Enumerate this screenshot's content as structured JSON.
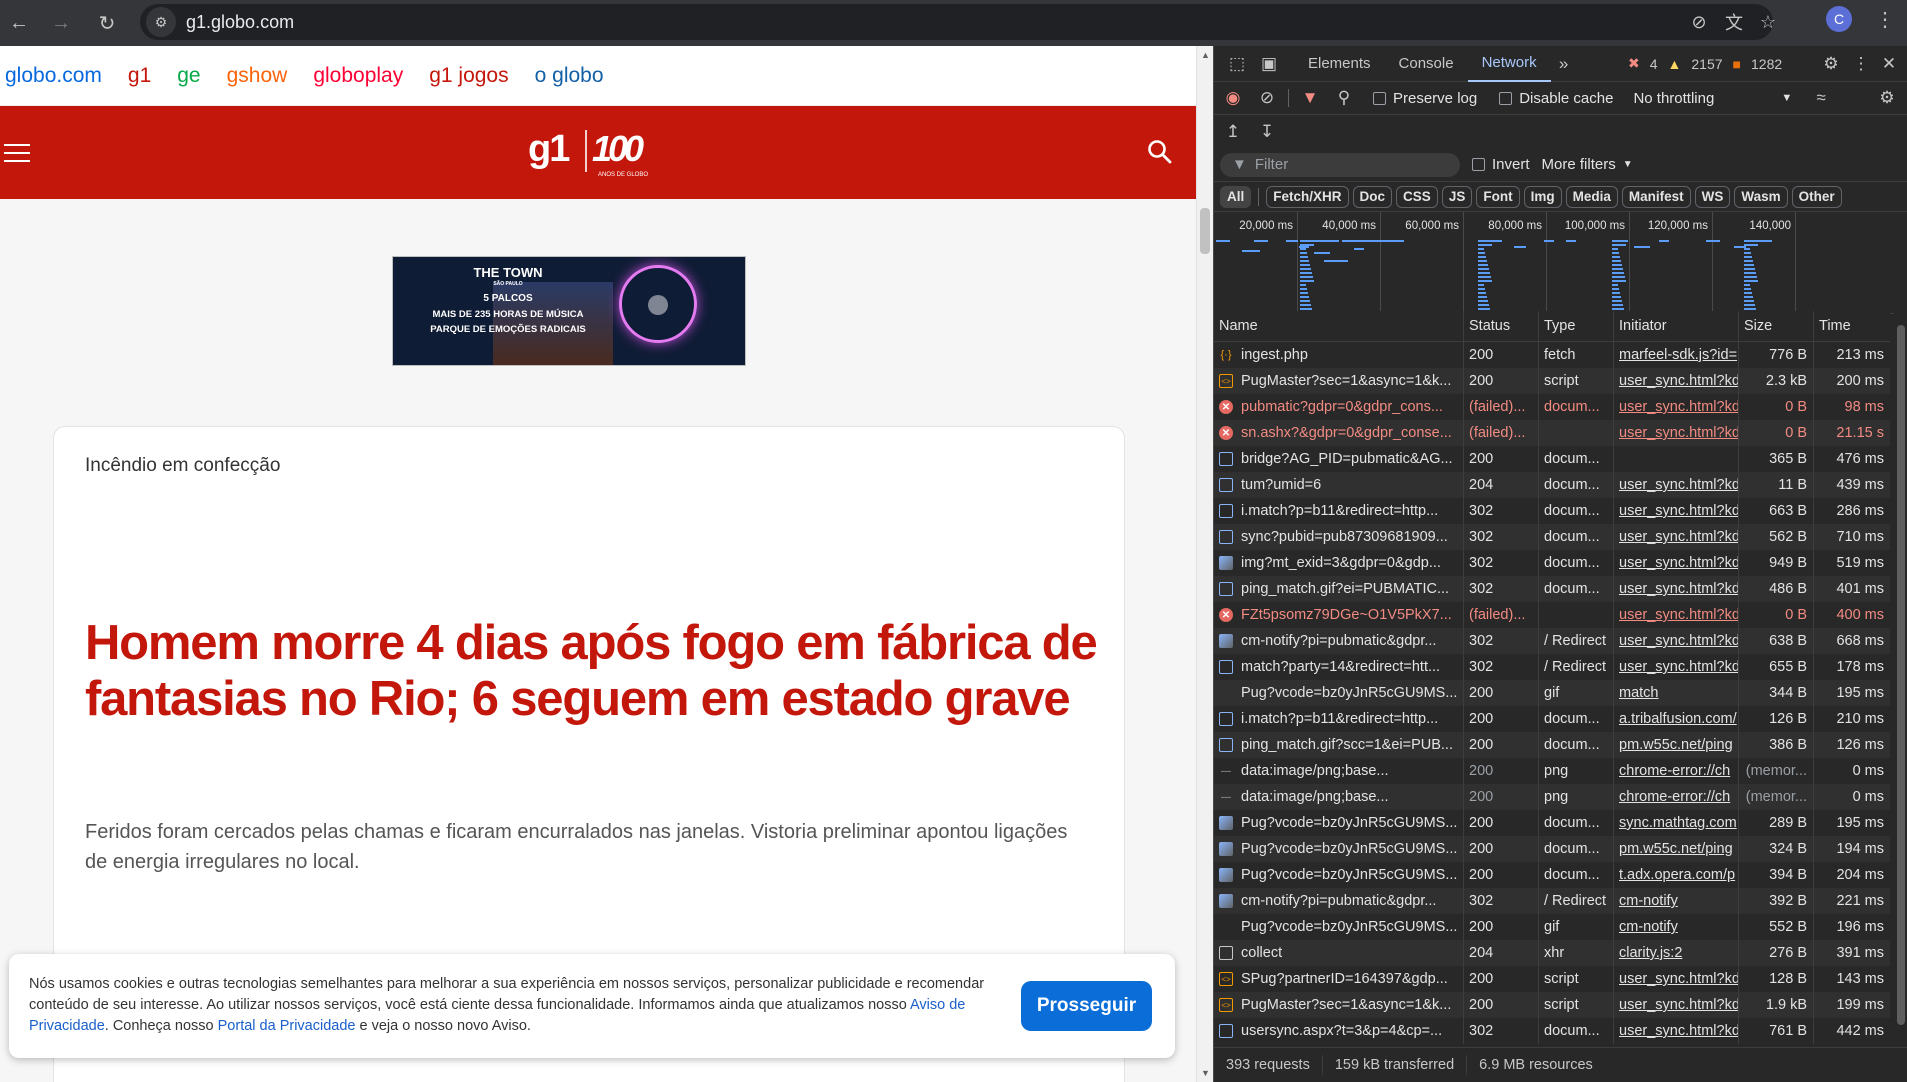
{
  "browser": {
    "url": "g1.globo.com",
    "profile_initial": "C",
    "icons": [
      "back-icon",
      "forward-icon",
      "reload-icon",
      "site-info-icon",
      "eye-off-icon",
      "translate-icon",
      "star-icon",
      "menu-icon"
    ]
  },
  "page": {
    "globo_links": [
      {
        "label": "globo.com",
        "color": "#0669de"
      },
      {
        "label": "g1",
        "color": "#c4170c"
      },
      {
        "label": "ge",
        "color": "#06aa48"
      },
      {
        "label": "gshow",
        "color": "#fa640a"
      },
      {
        "label": "globoplay",
        "color": "#fb0234"
      },
      {
        "label": "g1 jogos",
        "color": "#c4170c"
      },
      {
        "label": "o globo",
        "color": "#1460a7"
      }
    ],
    "logo": {
      "brand": "g1",
      "anniversary": "100",
      "anniversary_sub": "ANOS DE GLOBO"
    },
    "ad": {
      "title": "THE TOWN",
      "subtitle": "SÃO PAULO",
      "line1": "5 PALCOS",
      "line2": "MAIS DE 235 HORAS DE MÚSICA",
      "line3": "PARQUE DE EMOÇÕES RADICAIS"
    },
    "article": {
      "kicker": "Incêndio em confecção",
      "headline": "Homem morre 4 dias após fogo em fábrica de fantasias no Rio; 6 seguem em estado grave",
      "subhead": "Feridos foram cercados pelas chamas e ficaram encurralados nas janelas. Vistoria preliminar apontou ligações de energia irregulares no local."
    },
    "cookie": {
      "text_before": "Nós usamos cookies e outras tecnologias semelhantes para melhorar a sua experiência em nossos serviços, personalizar publicidade e recomendar conteúdo de seu interesse. Ao utilizar nossos serviços, você está ciente dessa funcionalidade. Informamos ainda que atualizamos nosso ",
      "link1": "Aviso de Privacidade",
      "text_mid": ". Conheça nosso ",
      "link2": "Portal da Privacidade",
      "text_after": " e veja o nosso novo Aviso.",
      "button": "Prosseguir"
    }
  },
  "devtools": {
    "tabs": [
      "Elements",
      "Console",
      "Network"
    ],
    "active_tab": "Network",
    "errors": "4",
    "warnings": "2157",
    "issues": "1282",
    "toolbar": {
      "preserve_log": "Preserve log",
      "disable_cache": "Disable cache",
      "throttling": "No throttling"
    },
    "filter": {
      "placeholder": "Filter",
      "invert": "Invert",
      "more_filters": "More filters"
    },
    "types": [
      "All",
      "Fetch/XHR",
      "Doc",
      "CSS",
      "JS",
      "Font",
      "Img",
      "Media",
      "Manifest",
      "WS",
      "Wasm",
      "Other"
    ],
    "timeline_ticks": [
      "20,000 ms",
      "40,000 ms",
      "60,000 ms",
      "80,000 ms",
      "100,000 ms",
      "120,000 ms",
      "140,000"
    ],
    "columns": [
      "Name",
      "Status",
      "Type",
      "Initiator",
      "Size",
      "Time"
    ],
    "rows": [
      {
        "icon": "fetch",
        "name": "ingest.php",
        "status": "200",
        "type": "fetch",
        "initiator": "marfeel-sdk.js?id=",
        "size": "776 B",
        "time": "213 ms"
      },
      {
        "icon": "script",
        "name": "PugMaster?sec=1&async=1&k...",
        "status": "200",
        "type": "script",
        "initiator": "user_sync.html?kd",
        "size": "2.3 kB",
        "time": "200 ms"
      },
      {
        "icon": "err",
        "name": "pubmatic?gdpr=0&gdpr_cons...",
        "status": "(failed)...",
        "type": "docum...",
        "initiator": "user_sync.html?kd",
        "size": "0 B",
        "time": "98 ms",
        "failed": true
      },
      {
        "icon": "err",
        "name": "sn.ashx?&gdpr=0&gdpr_conse...",
        "status": "(failed)...",
        "type": "",
        "initiator": "user_sync.html?kd",
        "size": "0 B",
        "time": "21.15 s",
        "failed": true
      },
      {
        "icon": "doc",
        "name": "bridge?AG_PID=pubmatic&AG...",
        "status": "200",
        "type": "docum...",
        "initiator": "",
        "size": "365 B",
        "time": "476 ms"
      },
      {
        "icon": "doc",
        "name": "tum?umid=6",
        "status": "204",
        "type": "docum...",
        "initiator": "user_sync.html?kd",
        "size": "11 B",
        "time": "439 ms"
      },
      {
        "icon": "doc",
        "name": "i.match?p=b11&redirect=http...",
        "status": "302",
        "type": "docum...",
        "initiator": "user_sync.html?kd",
        "size": "663 B",
        "time": "286 ms"
      },
      {
        "icon": "doc",
        "name": "sync?pubid=pub87309681909...",
        "status": "302",
        "type": "docum...",
        "initiator": "user_sync.html?kd",
        "size": "562 B",
        "time": "710 ms"
      },
      {
        "icon": "img",
        "name": "img?mt_exid=3&gdpr=0&gdp...",
        "status": "302",
        "type": "docum...",
        "initiator": "user_sync.html?kd",
        "size": "949 B",
        "time": "519 ms"
      },
      {
        "icon": "doc",
        "name": "ping_match.gif?ei=PUBMATIC...",
        "status": "302",
        "type": "docum...",
        "initiator": "user_sync.html?kd",
        "size": "486 B",
        "time": "401 ms"
      },
      {
        "icon": "err",
        "name": "FZt5psomz79DGe~O1V5PkX7...",
        "status": "(failed)...",
        "type": "",
        "initiator": "user_sync.html?kd",
        "size": "0 B",
        "time": "400 ms",
        "failed": true
      },
      {
        "icon": "img",
        "name": "cm-notify?pi=pubmatic&gdpr...",
        "status": "302",
        "type": "/ Redirect",
        "initiator": "user_sync.html?kd",
        "size": "638 B",
        "time": "668 ms"
      },
      {
        "icon": "doc",
        "name": "match?party=14&redirect=htt...",
        "status": "302",
        "type": "/ Redirect",
        "initiator": "user_sync.html?kd",
        "size": "655 B",
        "time": "178 ms"
      },
      {
        "icon": "blank",
        "name": "Pug?vcode=bz0yJnR5cGU9MS...",
        "status": "200",
        "type": "gif",
        "initiator": "match",
        "size": "344 B",
        "time": "195 ms"
      },
      {
        "icon": "doc",
        "name": "i.match?p=b11&redirect=http...",
        "status": "200",
        "type": "docum...",
        "initiator": "a.tribalfusion.com/",
        "size": "126 B",
        "time": "210 ms"
      },
      {
        "icon": "doc",
        "name": "ping_match.gif?scc=1&ei=PUB...",
        "status": "200",
        "type": "docum...",
        "initiator": "pm.w55c.net/ping",
        "size": "386 B",
        "time": "126 ms"
      },
      {
        "icon": "dash",
        "name": "data:image/png;base...",
        "status": "200",
        "type": "png",
        "initiator": "chrome-error://ch",
        "size": "(memor...",
        "time": "0 ms",
        "dim": true
      },
      {
        "icon": "dash",
        "name": "data:image/png;base...",
        "status": "200",
        "type": "png",
        "initiator": "chrome-error://ch",
        "size": "(memor...",
        "time": "0 ms",
        "dim": true
      },
      {
        "icon": "img",
        "name": "Pug?vcode=bz0yJnR5cGU9MS...",
        "status": "200",
        "type": "docum...",
        "initiator": "sync.mathtag.com",
        "size": "289 B",
        "time": "195 ms"
      },
      {
        "icon": "img",
        "name": "Pug?vcode=bz0yJnR5cGU9MS...",
        "status": "200",
        "type": "docum...",
        "initiator": "pm.w55c.net/ping",
        "size": "324 B",
        "time": "194 ms"
      },
      {
        "icon": "img",
        "name": "Pug?vcode=bz0yJnR5cGU9MS...",
        "status": "200",
        "type": "docum...",
        "initiator": "t.adx.opera.com/p",
        "size": "394 B",
        "time": "204 ms"
      },
      {
        "icon": "img",
        "name": "cm-notify?pi=pubmatic&gdpr...",
        "status": "302",
        "type": "/ Redirect",
        "initiator": "cm-notify",
        "size": "392 B",
        "time": "221 ms"
      },
      {
        "icon": "blank",
        "name": "Pug?vcode=bz0yJnR5cGU9MS...",
        "status": "200",
        "type": "gif",
        "initiator": "cm-notify",
        "size": "552 B",
        "time": "196 ms"
      },
      {
        "icon": "file",
        "name": "collect",
        "status": "204",
        "type": "xhr",
        "initiator": "clarity.js:2",
        "size": "276 B",
        "time": "391 ms"
      },
      {
        "icon": "script",
        "name": "SPug?partnerID=164397&gdp...",
        "status": "200",
        "type": "script",
        "initiator": "user_sync.html?kd",
        "size": "128 B",
        "time": "143 ms"
      },
      {
        "icon": "script",
        "name": "PugMaster?sec=1&async=1&k...",
        "status": "200",
        "type": "script",
        "initiator": "user_sync.html?kd",
        "size": "1.9 kB",
        "time": "199 ms"
      },
      {
        "icon": "doc",
        "name": "usersync.aspx?t=3&p=4&cp=...",
        "status": "302",
        "type": "docum...",
        "initiator": "user_sync.html?kd",
        "size": "761 B",
        "time": "442 ms"
      }
    ],
    "status_bar": {
      "requests": "393 requests",
      "transferred": "159 kB transferred",
      "resources": "6.9 MB resources"
    }
  }
}
